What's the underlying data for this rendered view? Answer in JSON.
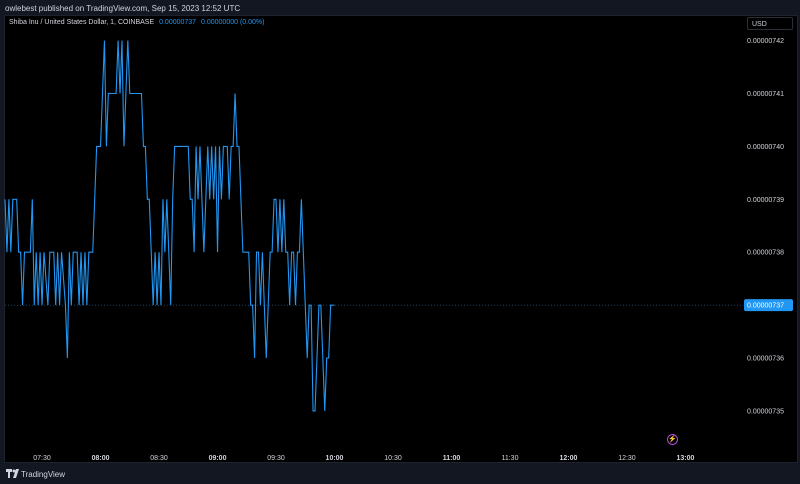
{
  "header": {
    "published": "owlebest published on TradingView.com, Sep 15, 2023 12:52 UTC"
  },
  "legend": {
    "symbol": "Shiba Inu / United States Dollar, 1, COINBASE",
    "price": "0.00000737",
    "change": "0.00000000 (0.00%)"
  },
  "currency_button": "USD",
  "footer": {
    "brand": "TradingView"
  },
  "colors": {
    "line": "#2196f3",
    "background": "#000000",
    "axis_text": "#d1d4dc",
    "badge": "#2196f3"
  },
  "icons": {
    "alert": "lightning-icon",
    "logo": "tradingview-logo-icon"
  },
  "chart_data": {
    "type": "line",
    "price_label": "0.00000737",
    "y_ticks": [
      7.42e-06,
      7.41e-06,
      7.4e-06,
      7.39e-06,
      7.38e-06,
      7.37e-06,
      7.36e-06,
      7.35e-06
    ],
    "y_tick_labels": [
      "0.00000742",
      "0.00000741",
      "0.00000740",
      "0.00000739",
      "0.00000738",
      "0.00000737",
      "0.00000736",
      "0.00000735"
    ],
    "ylim": [
      7.343e-06,
      7.422e-06
    ],
    "x_ticks": [
      {
        "label": "07:30",
        "time": "07:30",
        "bold": false
      },
      {
        "label": "08:00",
        "time": "08:00",
        "bold": true
      },
      {
        "label": "08:30",
        "time": "08:30",
        "bold": false
      },
      {
        "label": "09:00",
        "time": "09:00",
        "bold": true
      },
      {
        "label": "09:30",
        "time": "09:30",
        "bold": false
      },
      {
        "label": "10:00",
        "time": "10:00",
        "bold": true
      },
      {
        "label": "10:30",
        "time": "10:30",
        "bold": false
      },
      {
        "label": "11:00",
        "time": "11:00",
        "bold": true
      },
      {
        "label": "11:30",
        "time": "11:30",
        "bold": false
      },
      {
        "label": "12:00",
        "time": "12:00",
        "bold": true
      },
      {
        "label": "12:30",
        "time": "12:30",
        "bold": false
      },
      {
        "label": "13:00",
        "time": "13:00",
        "bold": true
      }
    ],
    "xlim": [
      "07:11",
      "13:29"
    ],
    "series": [
      {
        "points": [
          [
            "07:11",
            739
          ],
          [
            "07:12",
            738
          ],
          [
            "07:13",
            739
          ],
          [
            "07:14",
            738
          ],
          [
            "07:15",
            739
          ],
          [
            "07:17",
            739
          ],
          [
            "07:18",
            738
          ],
          [
            "07:19",
            738
          ],
          [
            "07:20",
            737
          ],
          [
            "07:21",
            738
          ],
          [
            "07:23",
            738
          ],
          [
            "07:24",
            738
          ],
          [
            "07:25",
            739
          ],
          [
            "07:26",
            737
          ],
          [
            "07:27",
            738
          ],
          [
            "07:28",
            737
          ],
          [
            "07:29",
            738
          ],
          [
            "07:30",
            737
          ],
          [
            "07:31",
            738
          ],
          [
            "07:33",
            737
          ],
          [
            "07:34",
            738
          ],
          [
            "07:36",
            738
          ],
          [
            "07:37",
            737
          ],
          [
            "07:38",
            738
          ],
          [
            "07:39",
            737
          ],
          [
            "07:40",
            738
          ],
          [
            "07:42",
            737
          ],
          [
            "07:43",
            736
          ],
          [
            "07:44",
            738
          ],
          [
            "07:45",
            737
          ],
          [
            "07:46",
            738
          ],
          [
            "07:48",
            738
          ],
          [
            "07:49",
            737
          ],
          [
            "07:50",
            738
          ],
          [
            "07:51",
            737
          ],
          [
            "07:52",
            738
          ],
          [
            "07:53",
            737
          ],
          [
            "07:54",
            738
          ],
          [
            "07:56",
            738
          ],
          [
            "07:57",
            739
          ],
          [
            "07:58",
            740
          ],
          [
            "08:00",
            740
          ],
          [
            "08:01",
            741
          ],
          [
            "08:02",
            742
          ],
          [
            "08:03",
            740
          ],
          [
            "08:04",
            741
          ],
          [
            "08:05",
            741
          ],
          [
            "08:08",
            741
          ],
          [
            "08:09",
            742
          ],
          [
            "08:10",
            741
          ],
          [
            "08:11",
            742
          ],
          [
            "08:12",
            740
          ],
          [
            "08:13",
            741
          ],
          [
            "08:14",
            742
          ],
          [
            "08:15",
            741
          ],
          [
            "08:17",
            741
          ],
          [
            "08:21",
            741
          ],
          [
            "08:22",
            740
          ],
          [
            "08:23",
            740
          ],
          [
            "08:24",
            739
          ],
          [
            "08:25",
            739
          ],
          [
            "08:26",
            738
          ],
          [
            "08:27",
            737
          ],
          [
            "08:28",
            738
          ],
          [
            "08:29",
            737
          ],
          [
            "08:30",
            738
          ],
          [
            "08:31",
            737
          ],
          [
            "08:32",
            739
          ],
          [
            "08:33",
            738
          ],
          [
            "08:34",
            739
          ],
          [
            "08:35",
            738
          ],
          [
            "08:36",
            737
          ],
          [
            "08:37",
            739
          ],
          [
            "08:38",
            740
          ],
          [
            "08:40",
            740
          ],
          [
            "08:45",
            740
          ],
          [
            "08:46",
            739
          ],
          [
            "08:47",
            739
          ],
          [
            "08:48",
            738
          ],
          [
            "08:49",
            740
          ],
          [
            "08:50",
            739
          ],
          [
            "08:51",
            740
          ],
          [
            "08:52",
            739
          ],
          [
            "08:53",
            738
          ],
          [
            "08:54",
            739
          ],
          [
            "08:55",
            740
          ],
          [
            "08:56",
            739
          ],
          [
            "08:57",
            740
          ],
          [
            "08:58",
            739
          ],
          [
            "08:59",
            740
          ],
          [
            "09:00",
            738
          ],
          [
            "09:01",
            740
          ],
          [
            "09:02",
            739
          ],
          [
            "09:03",
            740
          ],
          [
            "09:05",
            740
          ],
          [
            "09:06",
            739
          ],
          [
            "09:07",
            740
          ],
          [
            "09:08",
            740
          ],
          [
            "09:09",
            741
          ],
          [
            "09:10",
            740
          ],
          [
            "09:11",
            740
          ],
          [
            "09:12",
            739
          ],
          [
            "09:13",
            738
          ],
          [
            "09:14",
            738
          ],
          [
            "09:16",
            738
          ],
          [
            "09:17",
            737
          ],
          [
            "09:18",
            737
          ],
          [
            "09:19",
            736
          ],
          [
            "09:20",
            738
          ],
          [
            "09:21",
            738
          ],
          [
            "09:22",
            737
          ],
          [
            "09:23",
            738
          ],
          [
            "09:24",
            737
          ],
          [
            "09:25",
            736
          ],
          [
            "09:26",
            737
          ],
          [
            "09:27",
            738
          ],
          [
            "09:28",
            738
          ],
          [
            "09:29",
            739
          ],
          [
            "09:30",
            739
          ],
          [
            "09:31",
            738
          ],
          [
            "09:32",
            739
          ],
          [
            "09:33",
            738
          ],
          [
            "09:34",
            739
          ],
          [
            "09:35",
            738
          ],
          [
            "09:36",
            738
          ],
          [
            "09:37",
            737
          ],
          [
            "09:38",
            738
          ],
          [
            "09:39",
            738
          ],
          [
            "09:40",
            737
          ],
          [
            "09:41",
            738
          ],
          [
            "09:42",
            738
          ],
          [
            "09:43",
            739
          ],
          [
            "09:44",
            738
          ],
          [
            "09:45",
            737
          ],
          [
            "09:46",
            736
          ],
          [
            "09:47",
            737
          ],
          [
            "09:48",
            737
          ],
          [
            "09:49",
            735
          ],
          [
            "09:50",
            735
          ],
          [
            "09:51",
            736
          ],
          [
            "09:52",
            737
          ],
          [
            "09:53",
            737
          ],
          [
            "09:54",
            736
          ],
          [
            "09:55",
            735
          ],
          [
            "09:56",
            736
          ],
          [
            "09:57",
            736
          ],
          [
            "09:58",
            737
          ],
          [
            "09:59",
            737
          ],
          [
            "10:00",
            737
          ]
        ]
      }
    ]
  }
}
